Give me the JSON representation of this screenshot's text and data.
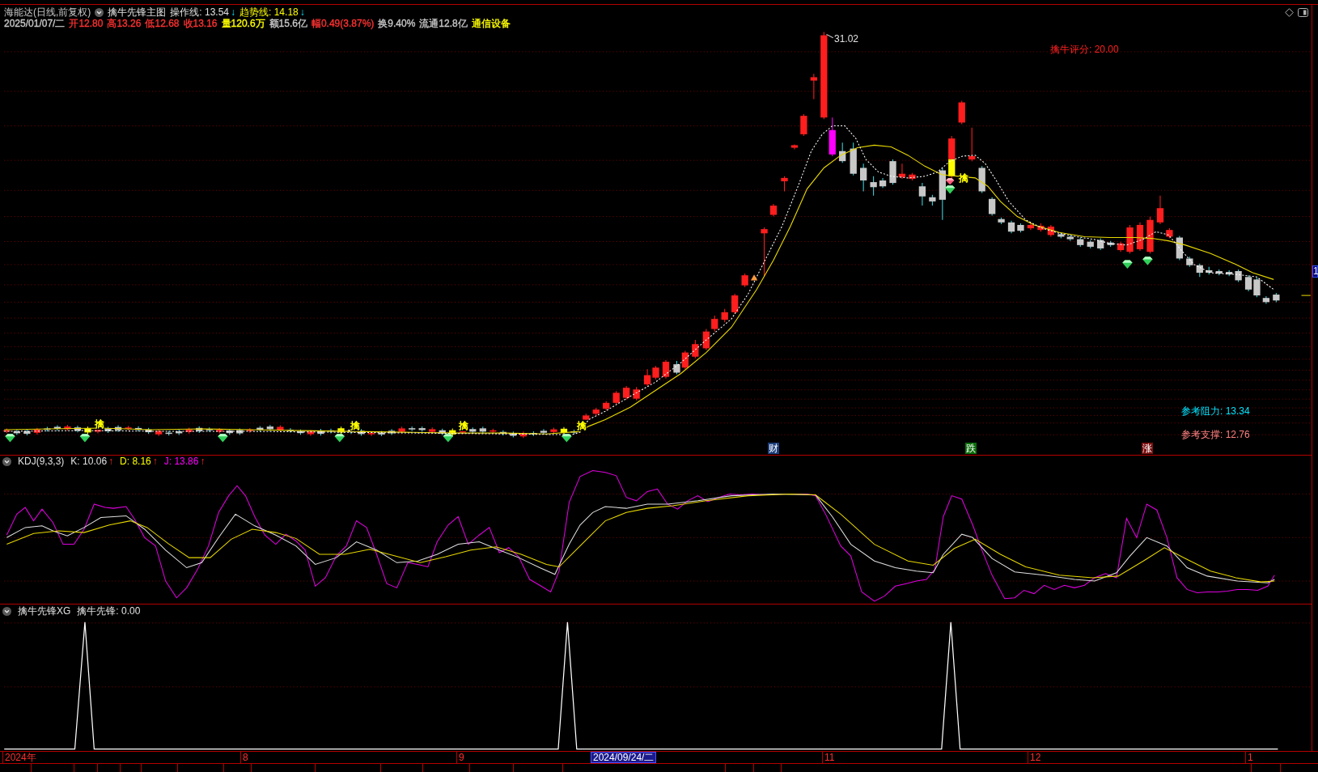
{
  "chart_header": {
    "title": "海能达(日线,前复权)",
    "indicator": "擒牛先锋主图",
    "lines": [
      {
        "text": "操作线: 13.54",
        "arrow": "↓",
        "color": "#e0e0e0"
      },
      {
        "text": "趋势线: 14.18",
        "arrow": "↓",
        "color": "#ffff00"
      }
    ]
  },
  "quote": {
    "date": "2025/01/07/二",
    "fields": [
      {
        "text": "开12.80",
        "color": "#ff3232"
      },
      {
        "text": "高13.26",
        "color": "#ff3232"
      },
      {
        "text": "低12.68",
        "color": "#ff3232"
      },
      {
        "text": "收13.16",
        "color": "#ff3232"
      },
      {
        "text": "量120.6万",
        "color": "#ffff00"
      },
      {
        "text": "额15.6亿",
        "color": "#c8c8c8"
      },
      {
        "text": "幅0.49(3.87%)",
        "color": "#ff3232"
      },
      {
        "text": "换9.40%",
        "color": "#c8c8c8"
      },
      {
        "text": "流通12.8亿",
        "color": "#c8c8c8"
      },
      {
        "text": "通信设备",
        "color": "#ffff00"
      }
    ]
  },
  "main_chart": {
    "high_label": "31.02",
    "score": "擒牛评分: 20.00",
    "resistance": "参考阻力: 13.34",
    "support": "参考支撑: 12.76",
    "signal_labels": [
      "擒",
      "擒",
      "擒",
      "擒",
      "擒"
    ],
    "event_tags": [
      {
        "text": "财",
        "color": "#1c3d7a"
      },
      {
        "text": "跌",
        "color": "#0b6e0b"
      },
      {
        "text": "涨",
        "color": "#7a1010"
      }
    ]
  },
  "price_axis": {
    "last_price_tag": "1"
  },
  "kdj_panel": {
    "title": "KDJ(9,3,3)",
    "values": [
      {
        "text": "K: 10.06",
        "arrow": "↑",
        "color": "#e0e0e0"
      },
      {
        "text": "D: 8.16",
        "arrow": "↑",
        "color": "#ffff00"
      },
      {
        "text": "J: 13.86",
        "arrow": "↑",
        "color": "#ff00ff"
      }
    ]
  },
  "signal_panel": {
    "title": "擒牛先锋XG",
    "values": [
      {
        "text": "擒牛先锋: 0.00"
      }
    ]
  },
  "time_axis": [
    {
      "label": "2024年",
      "kind": "tick"
    },
    {
      "label": "8",
      "kind": "tick"
    },
    {
      "label": "9",
      "kind": "tick"
    },
    {
      "label": "2024/09/24/二",
      "kind": "cursor"
    },
    {
      "label": "11",
      "kind": "tick"
    },
    {
      "label": "12",
      "kind": "tick"
    },
    {
      "label": "1",
      "kind": "tick"
    }
  ]
}
